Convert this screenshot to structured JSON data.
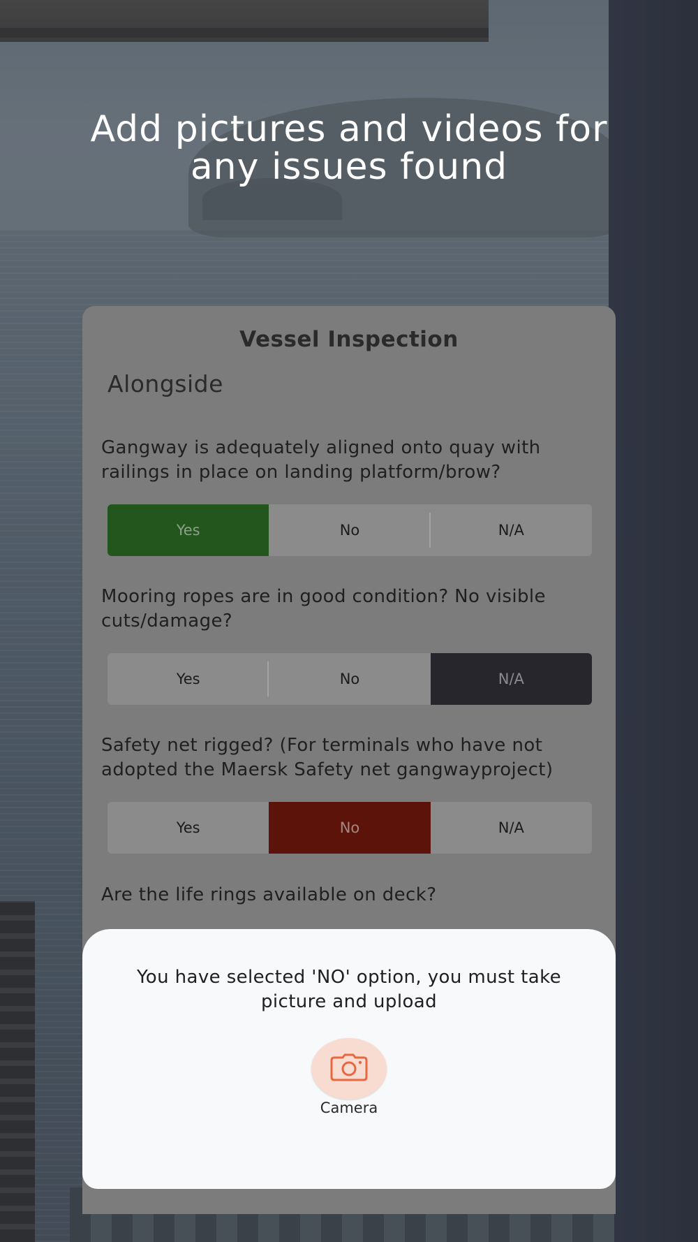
{
  "headline": "Add pictures and videos for any issues found",
  "form": {
    "title": "Vessel Inspection",
    "section": "Alongside",
    "questions": [
      {
        "text": "Gangway is adequately aligned onto quay with railings in place on landing platform/brow?",
        "options": [
          "Yes",
          "No",
          "N/A"
        ],
        "selected": "Yes"
      },
      {
        "text": "Mooring ropes are in good condition? No visible cuts/damage?",
        "options": [
          "Yes",
          "No",
          "N/A"
        ],
        "selected": "N/A"
      },
      {
        "text": "Safety net rigged? (For terminals who have not adopted the Maersk Safety net gangwayproject)",
        "options": [
          "Yes",
          "No",
          "N/A"
        ],
        "selected": "No"
      },
      {
        "text": "Are the life rings available on deck?"
      }
    ]
  },
  "sheet": {
    "message": "You have selected 'NO' option, you must take picture and upload",
    "camera_label": "Camera",
    "camera_icon": "camera-icon"
  },
  "colors": {
    "yes_selected": "#22561c",
    "no_selected": "#5c140a",
    "na_selected": "#26262c",
    "camera_accent": "#e8673f"
  }
}
